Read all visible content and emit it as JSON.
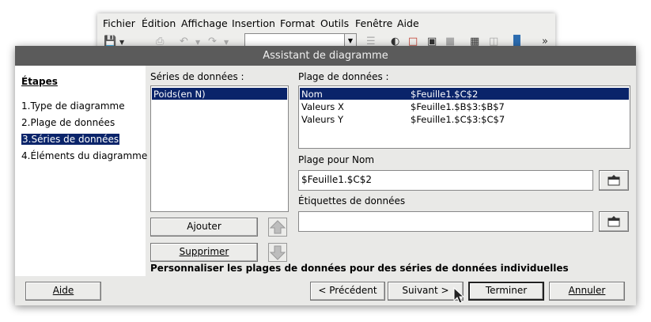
{
  "background_window": {
    "menu": [
      {
        "label": "Fichier",
        "accel": "F"
      },
      {
        "label": "Édition",
        "accel": "É"
      },
      {
        "label": "Affichage",
        "accel": "A"
      },
      {
        "label": "Insertion",
        "accel": "I"
      },
      {
        "label": "Format",
        "accel": "t"
      },
      {
        "label": "Outils",
        "accel": "O"
      },
      {
        "label": "Fenêtre",
        "accel": "n"
      },
      {
        "label": "Aide",
        "accel": "d"
      }
    ],
    "toolbar_icons": [
      "save-icon",
      "dropdown-icon",
      "print-icon",
      "undo-icon",
      "dropdown-icon",
      "redo-icon",
      "dropdown-icon",
      "chart-type-icon",
      "border-icon",
      "fill-icon",
      "wall-icon",
      "table-icon",
      "database-icon",
      "chart-icon",
      "overflow-icon"
    ]
  },
  "dialog": {
    "title": "Assistant de diagramme",
    "steps": {
      "heading": "Étapes",
      "items": [
        {
          "num": "1.",
          "label": "Type de diagramme"
        },
        {
          "num": "2.",
          "label": "Plage de données"
        },
        {
          "num": "3.",
          "label": "Séries de données"
        },
        {
          "num": "4.",
          "label": "Éléments du diagramme"
        }
      ],
      "selected_index": 2
    },
    "series": {
      "label": "Séries de données :",
      "items": [
        "Poids(en N)"
      ],
      "selected_index": 0,
      "add_button": "Ajouter",
      "remove_button": "Supprimer"
    },
    "ranges": {
      "label": "Plage de données :",
      "rows": [
        {
          "role": "Nom",
          "range": "$Feuille1.$C$2"
        },
        {
          "role": "Valeurs X",
          "range": "$Feuille1.$B$3:$B$7"
        },
        {
          "role": "Valeurs Y",
          "range": "$Feuille1.$C$3:$C$7"
        }
      ],
      "selected_index": 0
    },
    "range_for_name": {
      "label": "Plage pour Nom",
      "value": "$Feuille1.$C$2"
    },
    "data_labels": {
      "label": "Étiquettes de données",
      "value": ""
    },
    "description": "Personnaliser les plages de données pour des séries de données individuelles",
    "buttons": {
      "help": "Aide",
      "previous": "< Précédent",
      "next": "Suivant >",
      "finish": "Terminer",
      "cancel": "Annuler"
    }
  }
}
